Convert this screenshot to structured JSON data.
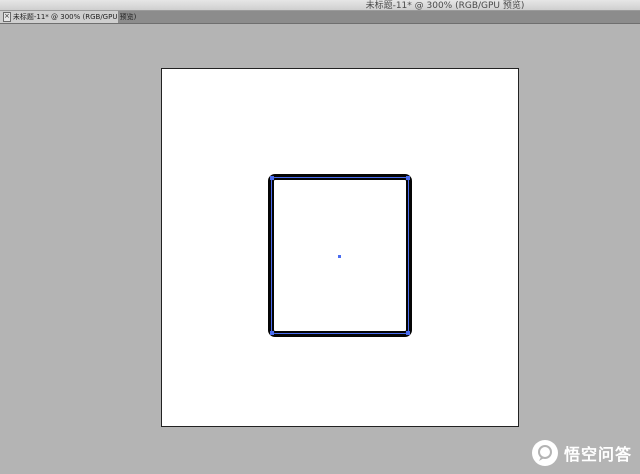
{
  "window": {
    "title": "未标题-11* @ 300% (RGB/GPU 预览)"
  },
  "tab": {
    "close_glyph": "×",
    "label": "未标题-11* @ 300% (RGB/GPU 预览)"
  },
  "canvas": {
    "artboard_color": "#ffffff",
    "stroke_color": "#050505",
    "selection_color": "#4a6cf0"
  },
  "watermark": {
    "text": "悟空问答",
    "icon": "chat-bubble-icon"
  }
}
